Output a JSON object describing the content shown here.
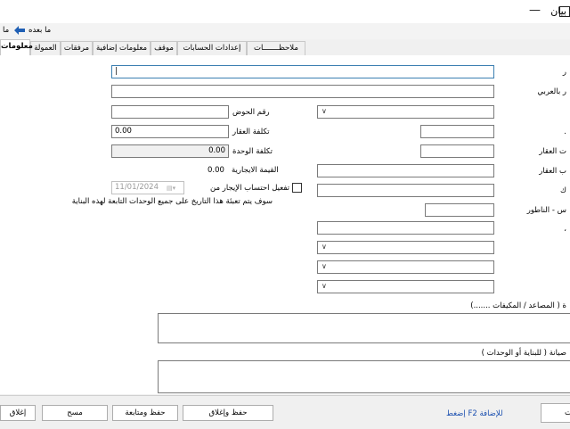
{
  "window": {
    "title": "بيان"
  },
  "toolbar": {
    "next_label": "ما بعده",
    "prev_label": "ما"
  },
  "tabs": [
    {
      "label": "معلومات"
    },
    {
      "label": "العمولة"
    },
    {
      "label": "مرفقات"
    },
    {
      "label": "معلومات إضافية"
    },
    {
      "label": "موقف"
    },
    {
      "label": "إعدادات الحسابات"
    },
    {
      "label": "ملاحظـــــــات"
    }
  ],
  "form": {
    "name_label": "ر",
    "name_ar_label": "ر بالعربي",
    "basin_label": "رقم الحوض",
    "cost_label": "تكلفة العقار",
    "cost_value": "0.00",
    "unit_cost_label": "تكلفة الوحدة",
    "unit_cost_value": "0.00",
    "rent_value_label": "القيمة الايجارية",
    "rent_value": "0.00",
    "rent_calc_label": "تفعيل احتساب الإيجار من",
    "rent_date": "11/01/2024",
    "note": "سوف يتم تعبئة هذا التاريخ على جميع الوحدات التابعة لهذه البناية",
    "right_label_1": ".",
    "right_label_2": "ت العقار",
    "right_label_3": "ب العقار",
    "right_label_4": "ك",
    "right_label_5": "س - الناطور",
    "right_label_6": "،",
    "equipment_label": "ة ( المصاعد / المكيفات .......)",
    "maintenance_label": "صيانة ( للبناية أو الوحدات )"
  },
  "footer": {
    "hint": "إضغط F2 للإضافة",
    "btn_save_close": "حفظ وإغلاق",
    "btn_save_continue": "حفظ ومتابعة",
    "btn_clear": "مسح",
    "btn_close": "إغلاق",
    "btn_right": "ت"
  }
}
